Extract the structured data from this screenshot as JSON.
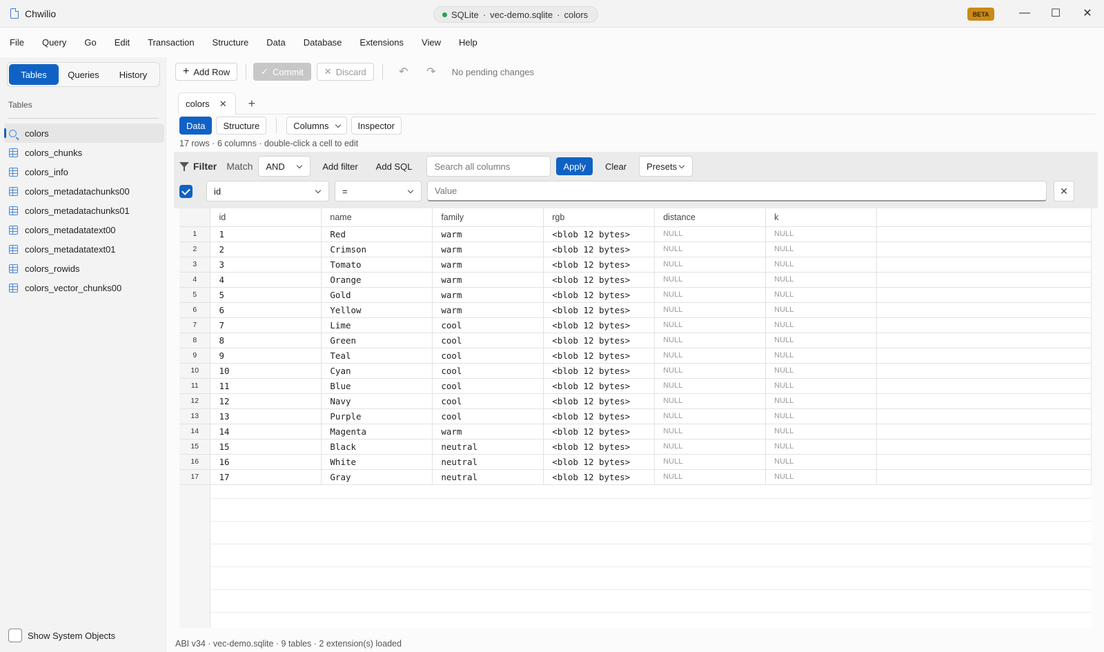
{
  "window": {
    "app_name": "Chwilio",
    "connection": {
      "engine": "SQLite",
      "file": "vec-demo.sqlite",
      "table": "colors",
      "separator": "·",
      "status_color": "#22a552"
    },
    "badge": "BETA",
    "controls": {
      "minimize": "—",
      "maximize": "☐",
      "close": "✕"
    }
  },
  "menu": [
    "File",
    "Query",
    "Go",
    "Edit",
    "Transaction",
    "Structure",
    "Data",
    "Database",
    "Extensions",
    "View",
    "Help"
  ],
  "sidebar": {
    "tabs": [
      {
        "label": "Tables",
        "active": true
      },
      {
        "label": "Queries",
        "active": false
      },
      {
        "label": "History",
        "active": false
      }
    ],
    "heading": "Tables",
    "items": [
      {
        "label": "colors",
        "icon": "search-icon",
        "active": true
      },
      {
        "label": "colors_chunks",
        "icon": "table-icon"
      },
      {
        "label": "colors_info",
        "icon": "table-icon"
      },
      {
        "label": "colors_metadatachunks00",
        "icon": "table-icon"
      },
      {
        "label": "colors_metadatachunks01",
        "icon": "table-icon"
      },
      {
        "label": "colors_metadatatext00",
        "icon": "table-icon"
      },
      {
        "label": "colors_metadatatext01",
        "icon": "table-icon"
      },
      {
        "label": "colors_rowids",
        "icon": "table-icon"
      },
      {
        "label": "colors_vector_chunks00",
        "icon": "table-icon"
      }
    ],
    "show_system": {
      "label": "Show System Objects",
      "checked": false
    }
  },
  "toolbar": {
    "add_row": "Add Row",
    "commit": "Commit",
    "discard": "Discard",
    "undo_icon": "undo-icon",
    "redo_icon": "redo-icon",
    "pending": "No pending changes"
  },
  "tabs": {
    "active": "colors",
    "add": "+"
  },
  "view": {
    "data": "Data",
    "structure": "Structure",
    "columns": "Columns",
    "inspector": "Inspector"
  },
  "meta": "17 rows  ·  6 columns  ·  double-click a cell to edit",
  "filter": {
    "label": "Filter",
    "match_label": "Match",
    "match_value": "AND",
    "add_filter": "Add filter",
    "add_sql": "Add SQL",
    "search_placeholder": "Search all columns",
    "apply": "Apply",
    "clear": "Clear",
    "presets": "Presets",
    "rule": {
      "enabled": true,
      "column": "id",
      "operator": "=",
      "value_placeholder": "Value"
    }
  },
  "grid": {
    "columns": [
      "id",
      "name",
      "family",
      "rgb",
      "distance",
      "k"
    ],
    "rows": [
      [
        "1",
        "1",
        "Red",
        "warm",
        "<blob 12 bytes>",
        "NULL",
        "NULL"
      ],
      [
        "2",
        "2",
        "Crimson",
        "warm",
        "<blob 12 bytes>",
        "NULL",
        "NULL"
      ],
      [
        "3",
        "3",
        "Tomato",
        "warm",
        "<blob 12 bytes>",
        "NULL",
        "NULL"
      ],
      [
        "4",
        "4",
        "Orange",
        "warm",
        "<blob 12 bytes>",
        "NULL",
        "NULL"
      ],
      [
        "5",
        "5",
        "Gold",
        "warm",
        "<blob 12 bytes>",
        "NULL",
        "NULL"
      ],
      [
        "6",
        "6",
        "Yellow",
        "warm",
        "<blob 12 bytes>",
        "NULL",
        "NULL"
      ],
      [
        "7",
        "7",
        "Lime",
        "cool",
        "<blob 12 bytes>",
        "NULL",
        "NULL"
      ],
      [
        "8",
        "8",
        "Green",
        "cool",
        "<blob 12 bytes>",
        "NULL",
        "NULL"
      ],
      [
        "9",
        "9",
        "Teal",
        "cool",
        "<blob 12 bytes>",
        "NULL",
        "NULL"
      ],
      [
        "10",
        "10",
        "Cyan",
        "cool",
        "<blob 12 bytes>",
        "NULL",
        "NULL"
      ],
      [
        "11",
        "11",
        "Blue",
        "cool",
        "<blob 12 bytes>",
        "NULL",
        "NULL"
      ],
      [
        "12",
        "12",
        "Navy",
        "cool",
        "<blob 12 bytes>",
        "NULL",
        "NULL"
      ],
      [
        "13",
        "13",
        "Purple",
        "cool",
        "<blob 12 bytes>",
        "NULL",
        "NULL"
      ],
      [
        "14",
        "14",
        "Magenta",
        "warm",
        "<blob 12 bytes>",
        "NULL",
        "NULL"
      ],
      [
        "15",
        "15",
        "Black",
        "neutral",
        "<blob 12 bytes>",
        "NULL",
        "NULL"
      ],
      [
        "16",
        "16",
        "White",
        "neutral",
        "<blob 12 bytes>",
        "NULL",
        "NULL"
      ],
      [
        "17",
        "17",
        "Gray",
        "neutral",
        "<blob 12 bytes>",
        "NULL",
        "NULL"
      ]
    ]
  },
  "status": "ABI v34  ·  vec-demo.sqlite  ·  9 tables  ·  2 extension(s) loaded",
  "colors": {
    "accent": "#0f62c4",
    "beta": "#c98a17"
  }
}
